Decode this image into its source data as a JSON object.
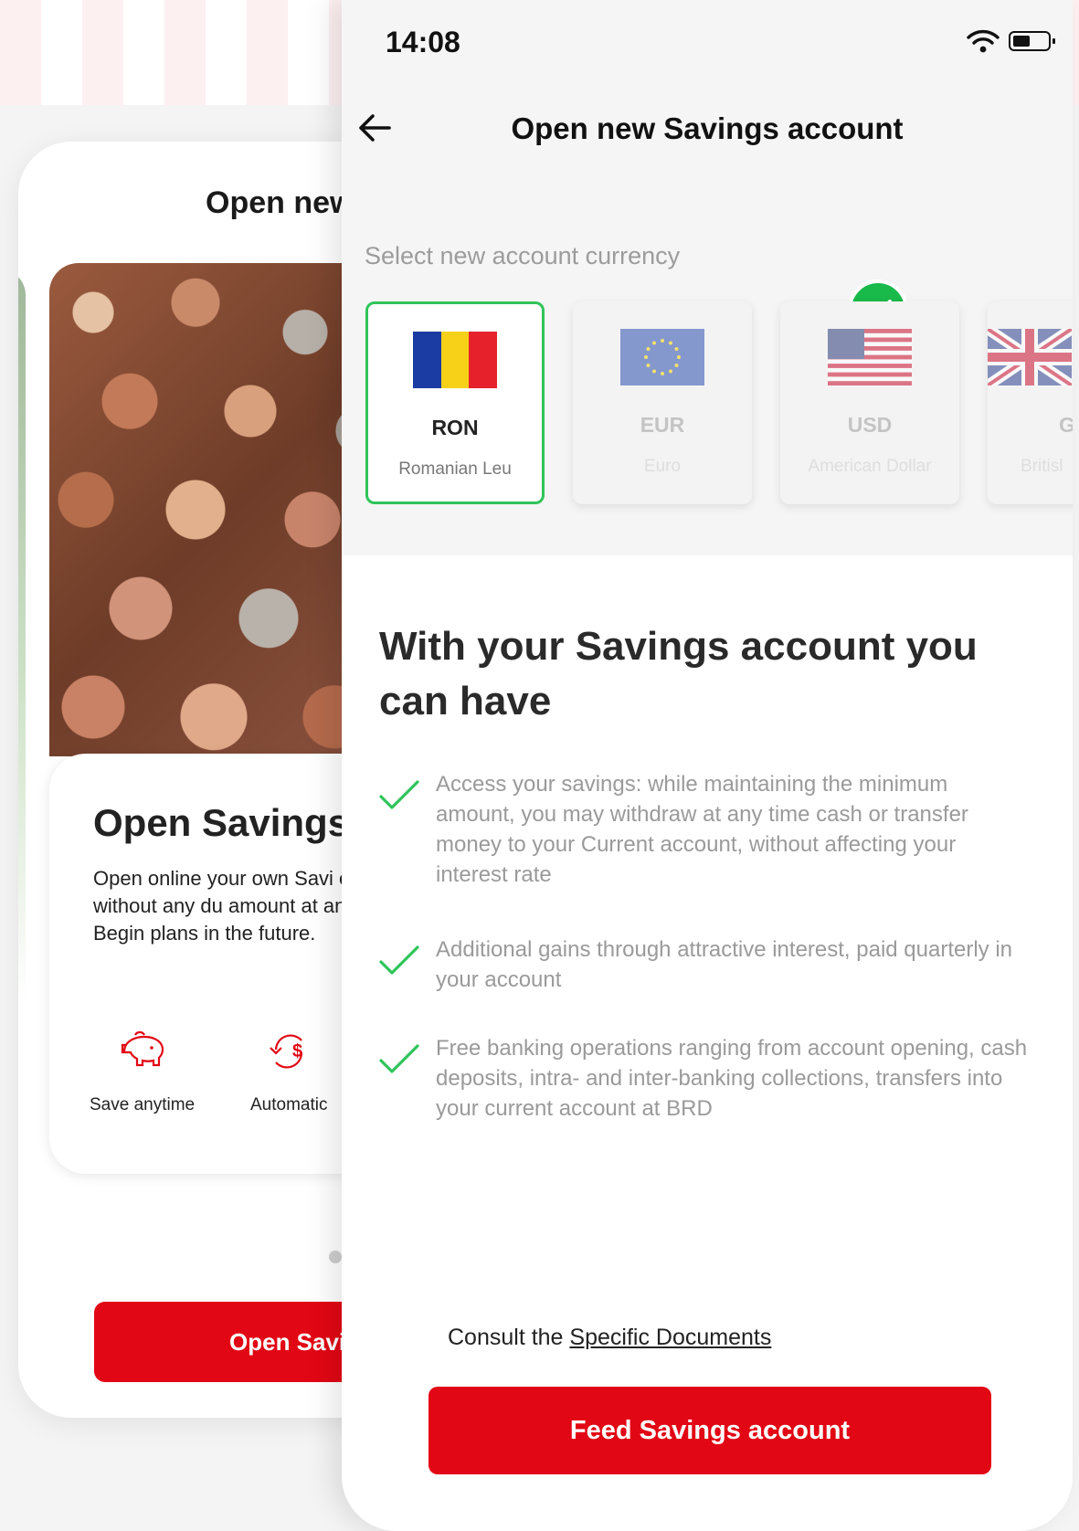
{
  "status_bar": {
    "time": "14:08"
  },
  "back_screen": {
    "title": "Open new",
    "card_title": "Open Savings a",
    "card_description": "Open online your own Savi effortlessly, without any du amount at any time. Begin plans in the future.",
    "features": [
      {
        "label": "Save anytime",
        "icon": "piggy-bank-icon"
      },
      {
        "label": "Automatic",
        "icon": "auto-transfer-icon"
      }
    ],
    "button_label": "Open Savi"
  },
  "header": {
    "title": "Open new Savings account"
  },
  "currency_section": {
    "label": "Select new account currency",
    "currencies": [
      {
        "code": "RON",
        "name": "Romanian Leu",
        "selected": true
      },
      {
        "code": "EUR",
        "name": "Euro",
        "selected": false
      },
      {
        "code": "USD",
        "name": "American Dollar",
        "selected": false
      },
      {
        "code": "G",
        "name": "Britisl",
        "selected": false
      }
    ]
  },
  "benefits": {
    "title": "With your Savings account you can have",
    "items": [
      "Access your savings: while maintaining the minimum amount, you may withdraw at any time cash or transfer money to your Current account, without affecting your interest rate",
      "Additional gains through attractive interest, paid quarterly in your account",
      "Free banking operations ranging from account opening, cash deposits, intra- and inter-banking collections, transfers into your current account at BRD"
    ]
  },
  "footer": {
    "consult_prefix": "Consult the ",
    "consult_link": "Specific Documents",
    "primary_button": "Feed Savings account"
  },
  "colors": {
    "brand_red": "#e20714",
    "check_green": "#2fc45a"
  }
}
